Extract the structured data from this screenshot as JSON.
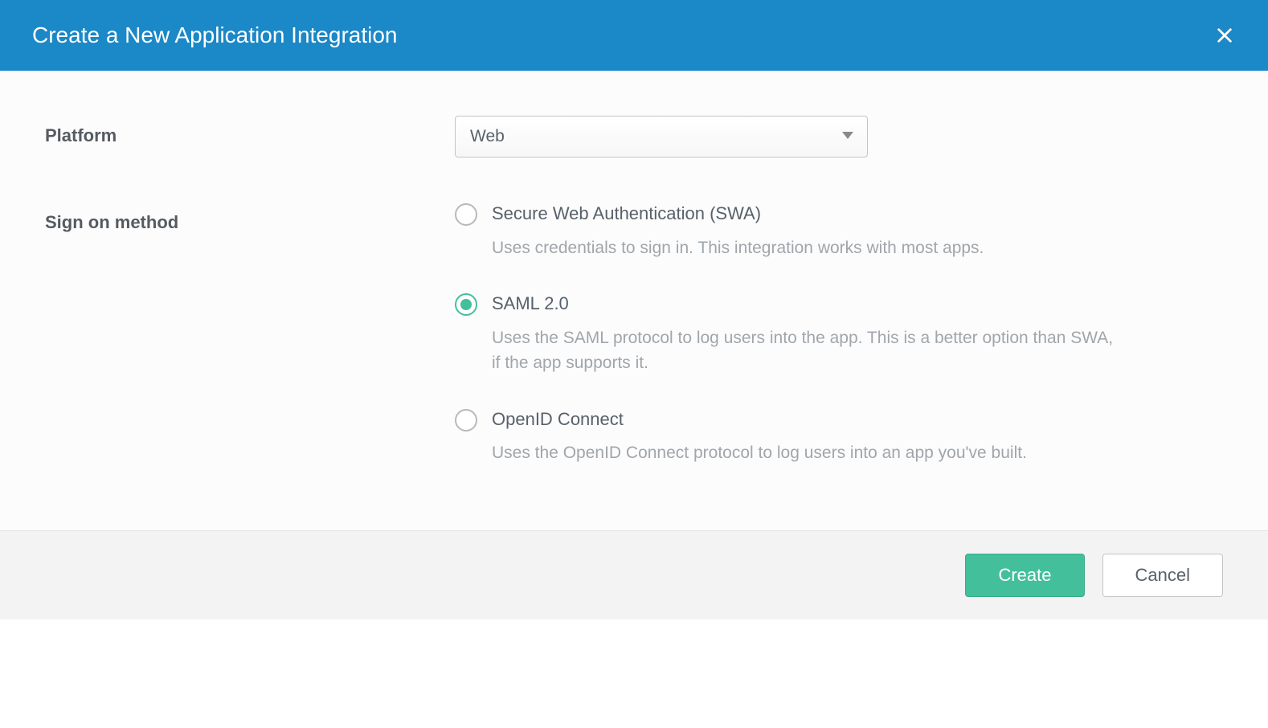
{
  "header": {
    "title": "Create a New Application Integration"
  },
  "form": {
    "platform": {
      "label": "Platform",
      "value": "Web"
    },
    "signOn": {
      "label": "Sign on method",
      "options": [
        {
          "title": "Secure Web Authentication (SWA)",
          "description": "Uses credentials to sign in. This integration works with most apps.",
          "selected": false
        },
        {
          "title": "SAML 2.0",
          "description": "Uses the SAML protocol to log users into the app. This is a better option than SWA, if the app supports it.",
          "selected": true
        },
        {
          "title": "OpenID Connect",
          "description": "Uses the OpenID Connect protocol to log users into an app you've built.",
          "selected": false
        }
      ]
    }
  },
  "footer": {
    "create": "Create",
    "cancel": "Cancel"
  }
}
